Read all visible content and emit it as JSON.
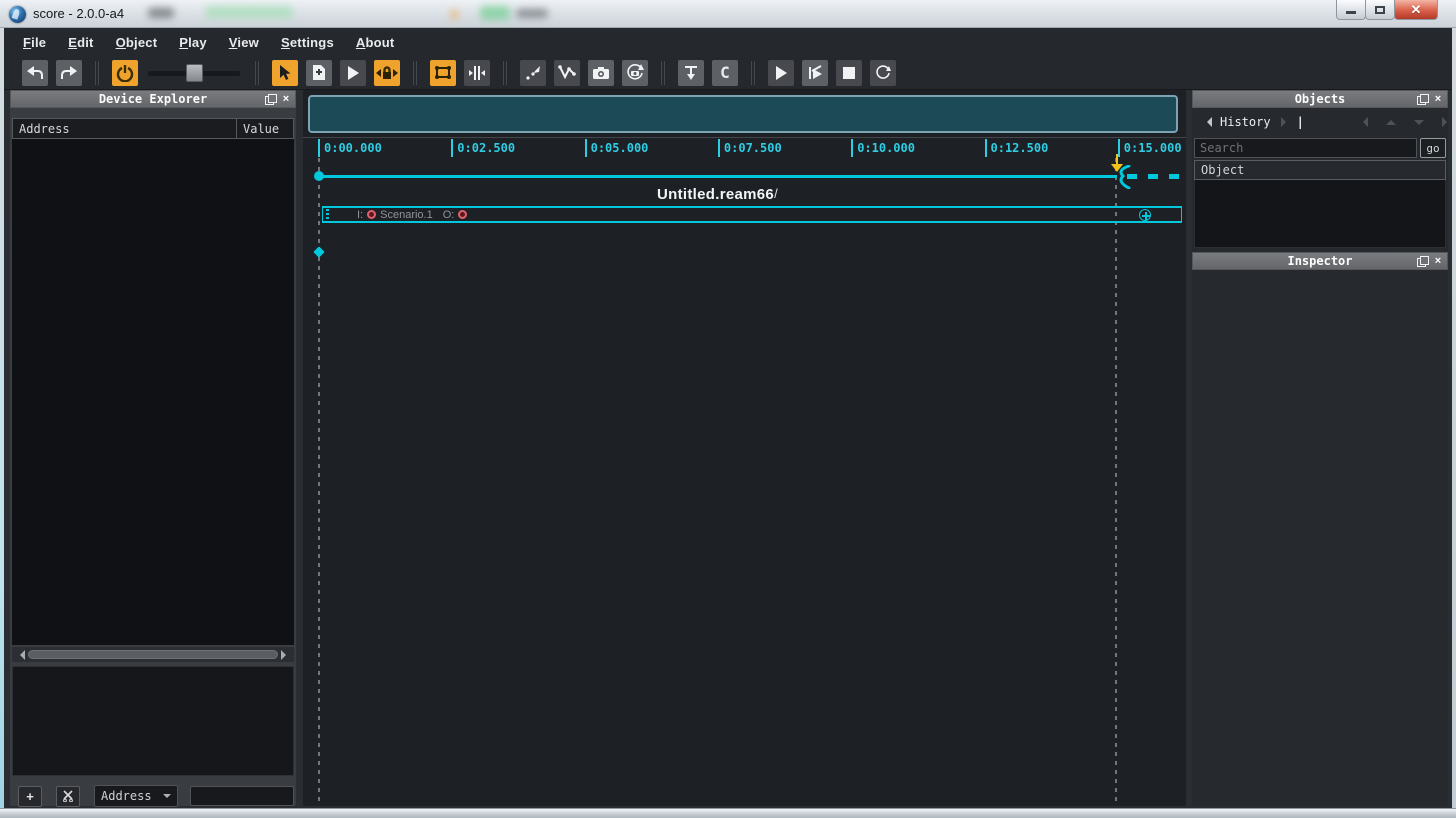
{
  "window": {
    "title": "score - 2.0.0-a4"
  },
  "menu": {
    "items": [
      {
        "name": "file",
        "label": "File"
      },
      {
        "name": "edit",
        "label": "Edit"
      },
      {
        "name": "object",
        "label": "Object"
      },
      {
        "name": "play",
        "label": "Play"
      },
      {
        "name": "view",
        "label": "View"
      },
      {
        "name": "settings",
        "label": "Settings"
      },
      {
        "name": "about",
        "label": "About"
      }
    ]
  },
  "toolbar": {
    "c_tool_label": "C"
  },
  "device_explorer": {
    "title": "Device Explorer",
    "columns": {
      "address": "Address",
      "value": "Value"
    },
    "footer": {
      "add_label": "+",
      "dropdown_value": "Address",
      "input_value": ""
    }
  },
  "timeline": {
    "ruler_ticks": [
      "0:00.000",
      "0:02.500",
      "0:05.000",
      "0:07.500",
      "0:10.000",
      "0:12.500",
      "0:15.000"
    ],
    "interval": {
      "name": "Untitled.ream66",
      "speed_glyph": "/",
      "slot": {
        "input_label": "I:",
        "title": "Scenario.1",
        "output_label": "O:"
      }
    }
  },
  "objects_panel": {
    "title": "Objects",
    "history_label": "History",
    "history_cursor": "|",
    "search_placeholder": "Search",
    "go_label": "go",
    "list_header": "Object"
  },
  "inspector_panel": {
    "title": "Inspector"
  },
  "colors": {
    "accent_cyan": "#00c8dd",
    "accent_orange": "#efa32d",
    "trigger_yellow": "#f2c218",
    "port_red": "#e2606c",
    "minimap_fill": "#1c4a57"
  }
}
